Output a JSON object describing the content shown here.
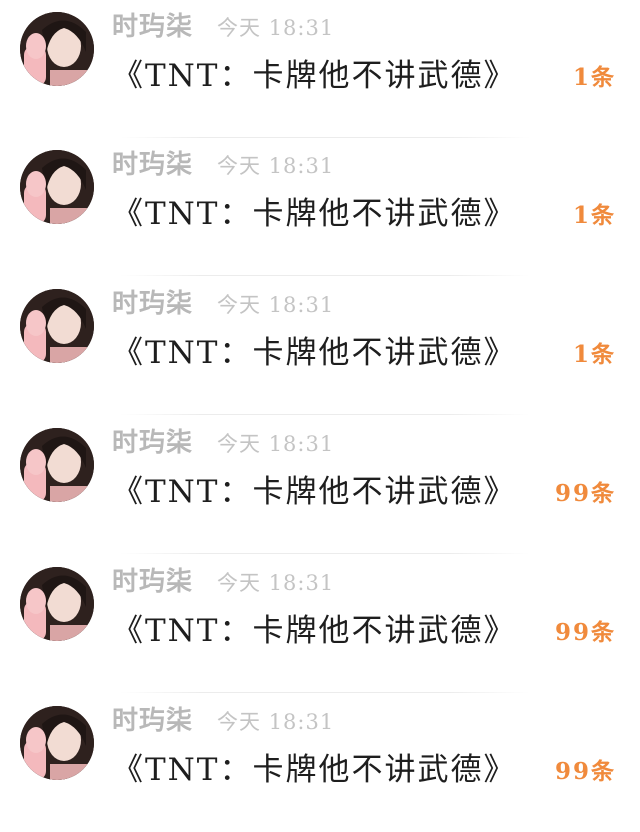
{
  "messages": [
    {
      "author": "时玙柒",
      "time": "今天 18:31",
      "title": "《TNT：卡牌他不讲武德》",
      "count": "1条"
    },
    {
      "author": "时玙柒",
      "time": "今天 18:31",
      "title": "《TNT：卡牌他不讲武德》",
      "count": "1条"
    },
    {
      "author": "时玙柒",
      "time": "今天 18:31",
      "title": "《TNT：卡牌他不讲武德》",
      "count": "1条"
    },
    {
      "author": "时玙柒",
      "time": "今天 18:31",
      "title": "《TNT：卡牌他不讲武德》",
      "count": "99条"
    },
    {
      "author": "时玙柒",
      "time": "今天 18:31",
      "title": "《TNT：卡牌他不讲武德》",
      "count": "99条"
    },
    {
      "author": "时玙柒",
      "time": "今天 18:31",
      "title": "《TNT：卡牌他不讲武德》",
      "count": "99条"
    }
  ],
  "colors": {
    "count_accent": "#f08a3c",
    "meta_gray": "#b8b8b8",
    "title_text": "#1e1e1e"
  },
  "icons": {
    "avatar": "user-avatar-photo"
  }
}
